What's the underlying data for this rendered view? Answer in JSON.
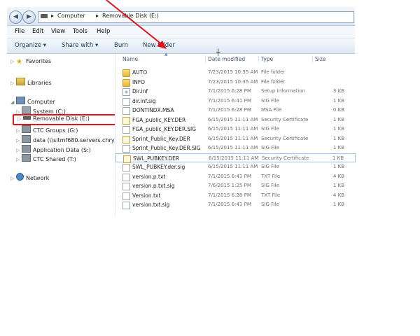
{
  "breadcrumb": [
    "Computer",
    "Removable Disk (E:)"
  ],
  "menu": [
    "File",
    "Edit",
    "View",
    "Tools",
    "Help"
  ],
  "toolbar": {
    "organize": "Organize ▾",
    "share_with": "Share with ▾",
    "burn": "Burn",
    "new_folder": "New folder"
  },
  "nav": {
    "favorites": "Favorites",
    "libraries": "Libraries",
    "computer": "Computer",
    "system": "System (C:)",
    "removable": "Removable Disk (E:)",
    "ctc_groups": "CTC Groups (G:)",
    "data": "data (\\\\sitmf680.servers.chrys",
    "application_data": "Application Data (S:)",
    "ctc_shared": "CTC Shared (T:)",
    "network": "Network"
  },
  "columns": {
    "name": "Name",
    "date": "Date modified",
    "type": "Type",
    "size": "Size"
  },
  "files": [
    {
      "name": "AUTO",
      "date": "7/23/2015 10:35 AM",
      "type": "File folder",
      "size": "",
      "icon": "folder"
    },
    {
      "name": "INFO",
      "date": "7/23/2015 10:35 AM",
      "type": "File folder",
      "size": "",
      "icon": "folder"
    },
    {
      "name": "Dir.inf",
      "date": "7/1/2015 6:28 PM",
      "type": "Setup Information",
      "size": "3 KB",
      "icon": "gear"
    },
    {
      "name": "dir.inf.sig",
      "date": "7/1/2015 6:41 PM",
      "type": "SIG File",
      "size": "1 KB",
      "icon": "doc"
    },
    {
      "name": "DONTINDX.MSA",
      "date": "7/1/2015 6:28 PM",
      "type": "MSA File",
      "size": "0 KB",
      "icon": "doc"
    },
    {
      "name": "FGA_public_KEY.DER",
      "date": "6/15/2015 11:11 AM",
      "type": "Security Certificate",
      "size": "1 KB",
      "icon": "cert"
    },
    {
      "name": "FGA_public_KEY.DER.SIG",
      "date": "6/15/2015 11:11 AM",
      "type": "SIG File",
      "size": "1 KB",
      "icon": "doc"
    },
    {
      "name": "Sprint_Public_Key.DER",
      "date": "6/15/2015 11:11 AM",
      "type": "Security Certificate",
      "size": "1 KB",
      "icon": "cert"
    },
    {
      "name": "Sprint_Public_Key.DER.SIG",
      "date": "6/15/2015 11:11 AM",
      "type": "SIG File",
      "size": "1 KB",
      "icon": "doc"
    },
    {
      "name": "SWL_PUBKEY.DER",
      "date": "6/15/2015 11:11 AM",
      "type": "Security Certificate",
      "size": "1 KB",
      "icon": "cert"
    },
    {
      "name": "SWL_PUBKEY.der.sig",
      "date": "6/15/2015 11:11 AM",
      "type": "SIG File",
      "size": "1 KB",
      "icon": "doc"
    },
    {
      "name": "version.p.txt",
      "date": "7/1/2015 6:41 PM",
      "type": "TXT File",
      "size": "4 KB",
      "icon": "doc"
    },
    {
      "name": "version.p.txt.sig",
      "date": "7/6/2015 1:25 PM",
      "type": "SIG File",
      "size": "1 KB",
      "icon": "doc"
    },
    {
      "name": "Version.txt",
      "date": "7/1/2015 6:28 PM",
      "type": "TXT File",
      "size": "4 KB",
      "icon": "doc"
    },
    {
      "name": "version.txt.sig",
      "date": "7/1/2015 6:41 PM",
      "type": "SIG File",
      "size": "1 KB",
      "icon": "doc"
    }
  ],
  "colors": {
    "annotation_red": "#e0121a",
    "selection_border": "#9ec4ea"
  }
}
